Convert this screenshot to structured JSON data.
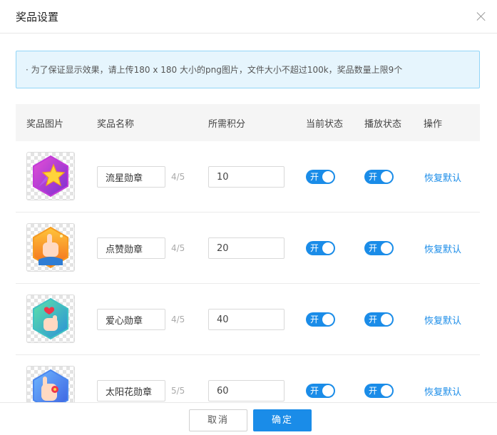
{
  "dialog": {
    "title": "奖品设置",
    "notice": "· 为了保证显示效果，请上传180 x 180 大小的png图片，文件大小不超过100k，奖品数量上限9个"
  },
  "table": {
    "headers": {
      "image": "奖品图片",
      "name": "奖品名称",
      "points": "所需积分",
      "status": "当前状态",
      "play_status": "播放状态",
      "actions": "操作"
    },
    "rows": [
      {
        "name": "流星勋章",
        "counter": "4/5",
        "points": "10",
        "status_label": "开",
        "play_label": "开",
        "action": "恢复默认",
        "icon": "shooting-star-badge-icon"
      },
      {
        "name": "点赞勋章",
        "counter": "4/5",
        "points": "20",
        "status_label": "开",
        "play_label": "开",
        "action": "恢复默认",
        "icon": "thumbs-up-badge-icon"
      },
      {
        "name": "爱心勋章",
        "counter": "4/5",
        "points": "40",
        "status_label": "开",
        "play_label": "开",
        "action": "恢复默认",
        "icon": "finger-heart-badge-icon"
      },
      {
        "name": "太阳花勋章",
        "counter": "5/5",
        "points": "60",
        "status_label": "开",
        "play_label": "开",
        "action": "恢复默认",
        "icon": "sunflower-hand-badge-icon"
      }
    ]
  },
  "footer": {
    "cancel_label": "取消",
    "ok_label": "确定"
  },
  "colors": {
    "accent": "#1a8ce8",
    "notice_bg": "#e6f5fd",
    "notice_border": "#91d5f7"
  }
}
